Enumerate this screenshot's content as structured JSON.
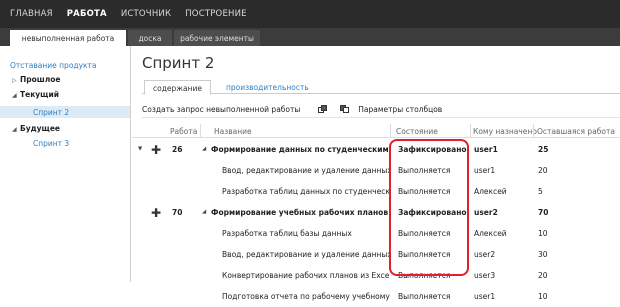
{
  "topnav": {
    "items": [
      "ГЛАВНАЯ",
      "РАБОТА",
      "ИСТОЧНИК",
      "ПОСТРОЕНИЕ"
    ],
    "active_index": 1
  },
  "subnav": {
    "tabs": [
      "невыполненная работа",
      "доска",
      "рабочие элементы"
    ],
    "active_index": 0
  },
  "sidebar": {
    "backlog_link": "Отставание продукта",
    "groups": [
      {
        "label": "Прошлое",
        "expanded": false
      },
      {
        "label": "Текущий",
        "expanded": true,
        "items": [
          "Спринт 2"
        ]
      },
      {
        "label": "Будущее",
        "expanded": true,
        "items": [
          "Спринт 3"
        ]
      }
    ]
  },
  "main": {
    "title": "Спринт 2",
    "tabs": [
      "содержание",
      "производительность"
    ],
    "active_tab": 0,
    "toolbar": {
      "create_query": "Создать запрос невыполненной работы",
      "column_options": "Параметры столбцов"
    },
    "columns": [
      "Работа",
      "Название",
      "Состояние",
      "Кому назначено",
      "Оставшаяся работа"
    ],
    "rows": [
      {
        "level": 0,
        "work": "26",
        "title": "Формирование данных по студенческим гр...",
        "state": "Зафиксировано",
        "assigned": "user1",
        "remaining": "25"
      },
      {
        "level": 1,
        "work": "",
        "title": "Ввод, редактирование и удаление данных п...",
        "state": "Выполняется",
        "assigned": "user1",
        "remaining": "20"
      },
      {
        "level": 1,
        "work": "",
        "title": "Разработка таблиц данных по студенческ...",
        "state": "Выполняется",
        "assigned": "Алексей",
        "remaining": "5"
      },
      {
        "level": 0,
        "work": "70",
        "title": "Формирование учебных рабочих планов",
        "state": "Зафиксировано",
        "assigned": "user2",
        "remaining": "70"
      },
      {
        "level": 1,
        "work": "",
        "title": "Разработка таблиц базы данных",
        "state": "Выполняется",
        "assigned": "Алексей",
        "remaining": "10"
      },
      {
        "level": 1,
        "work": "",
        "title": "Ввод, редактирование и удаление данных п...",
        "state": "Выполняется",
        "assigned": "user2",
        "remaining": "30"
      },
      {
        "level": 1,
        "work": "",
        "title": "Конвертирование рабочих планов из Excel в...",
        "state": "Выполняется",
        "assigned": "user3",
        "remaining": "20"
      },
      {
        "level": 1,
        "work": "",
        "title": "Подготовка отчета по рабочему учебному п...",
        "state": "Выполняется",
        "assigned": "user1",
        "remaining": "10"
      }
    ]
  },
  "colors": {
    "topbar": "#2b2b2b",
    "link": "#2f7fc0",
    "highlight": "#e0202a",
    "selected": "#dcebf7"
  }
}
